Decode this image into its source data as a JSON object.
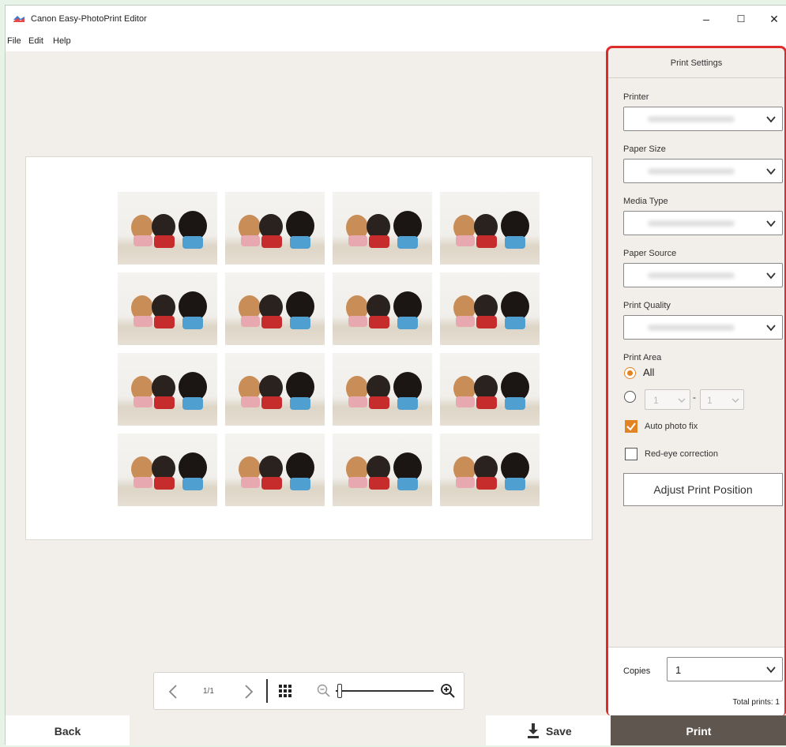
{
  "window": {
    "title": "Canon Easy-PhotoPrint Editor",
    "controls": {
      "minimize": "–",
      "maximize": "☐",
      "close": "✕"
    }
  },
  "menu": {
    "items": [
      "File",
      "Edit",
      "Help"
    ]
  },
  "preview": {
    "page_indicator": "1/1",
    "photo_count": 16,
    "zoom_level": 0.02
  },
  "print_settings": {
    "title": "Print Settings",
    "printer_label": "Printer",
    "paper_size_label": "Paper Size",
    "media_type_label": "Media Type",
    "paper_source_label": "Paper Source",
    "print_quality_label": "Print Quality",
    "print_area_label": "Print Area",
    "print_area_all": "All",
    "range_from": "1",
    "range_sep": "-",
    "range_to": "1",
    "auto_photo_fix": "Auto photo fix",
    "red_eye_correction": "Red-eye correction",
    "adjust_button": "Adjust Print Position",
    "copies_label": "Copies",
    "copies_value": "1",
    "total_prints": "Total prints: 1"
  },
  "bottom": {
    "back": "Back",
    "save": "Save",
    "print": "Print"
  },
  "colors": {
    "accent": "#e38424",
    "highlight": "#e02b2b",
    "print_button": "#5f5650"
  },
  "icons": [
    "app-logo-icon",
    "chevron-left-icon",
    "chevron-right-icon",
    "grid-view-icon",
    "zoom-out-icon",
    "zoom-in-icon",
    "download-icon",
    "chevron-down-icon"
  ]
}
